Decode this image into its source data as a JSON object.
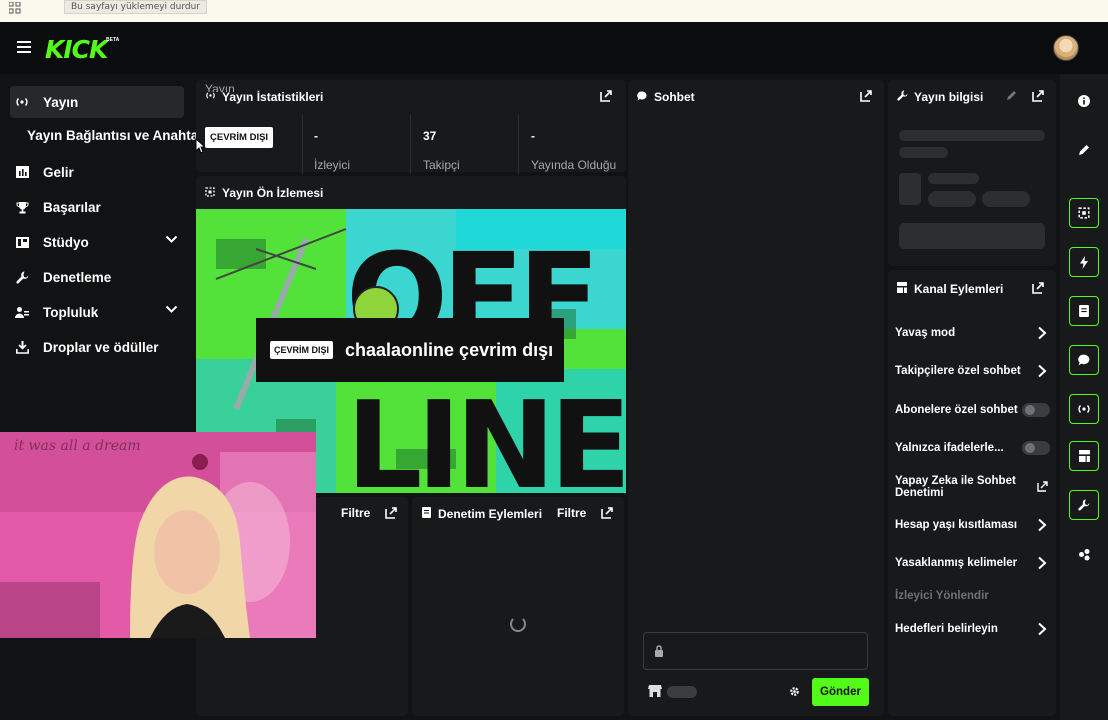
{
  "browser": {
    "tooltip": "Bu sayfayı yüklemeyi durdur"
  },
  "header": {
    "logo": "KICK",
    "beta": "BETA"
  },
  "sidebar": {
    "items": [
      {
        "label": "Yayın",
        "icon": "broadcast-icon"
      },
      {
        "label": "Yayın Bağlantısı ve Anahtarı"
      },
      {
        "label": "Gelir",
        "icon": "chart-icon"
      },
      {
        "label": "Başarılar",
        "icon": "trophy-icon"
      },
      {
        "label": "Stüdyo",
        "icon": "studio-icon"
      },
      {
        "label": "Denetleme",
        "icon": "wrench-icon"
      },
      {
        "label": "Topluluk",
        "icon": "community-icon"
      },
      {
        "label": "Droplar ve ödüller",
        "icon": "drops-icon"
      }
    ]
  },
  "stats": {
    "title": "Yayın İstatistikleri",
    "status_badge": "ÇEVRİM DIŞI",
    "status_label": "Yayın",
    "viewers_value": "-",
    "viewers_label": "İzleyici",
    "followers_value": "37",
    "followers_label": "Takipçi",
    "uptime_value": "-",
    "uptime_label": "Yayında Olduğu"
  },
  "preview": {
    "title": "Yayın Ön İzlemesi",
    "badge": "ÇEVRİM DIŞI",
    "caption": "chaalaonline çevrim dışı",
    "image_text_top": "OFF",
    "image_text_bottom": "LINE"
  },
  "webcam": {
    "overlay_text": "it was all a dream"
  },
  "activity": {
    "filter": "Filtre"
  },
  "moderation": {
    "title": "Denetim Eylemleri",
    "filter": "Filtre"
  },
  "chat": {
    "title": "Sohbet",
    "send": "Gönder"
  },
  "stream_info": {
    "title": "Yayın bilgisi"
  },
  "channel_actions": {
    "title": "Kanal Eylemleri",
    "items": [
      {
        "label": "Yavaş mod",
        "control": "chevron"
      },
      {
        "label": "Takipçilere özel sohbet",
        "control": "chevron"
      },
      {
        "label": "Abonelere özel sohbet",
        "control": "toggle",
        "enabled": false
      },
      {
        "label": "Yalnızca ifadelerle...",
        "control": "toggle",
        "enabled": false
      },
      {
        "label": "Yapay Zeka ile Sohbet Denetimi",
        "control": "external"
      },
      {
        "label": "Hesap yaşı kısıtlaması",
        "control": "chevron"
      },
      {
        "label": "Yasaklanmış kelimeler",
        "control": "chevron"
      },
      {
        "label": "İzleyici Yönlendir",
        "control": "none",
        "disabled": true
      },
      {
        "label": "Hedefleri belirleyin",
        "control": "chevron"
      }
    ]
  },
  "colors": {
    "accent": "#53fc18",
    "background": "#111213",
    "panel": "#18191b"
  }
}
